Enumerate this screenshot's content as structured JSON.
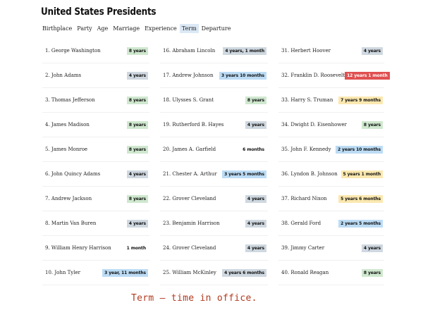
{
  "page": {
    "title": "United States Presidents",
    "caption": "Term – time in office."
  },
  "tabs": [
    {
      "label": "Birthplace",
      "active": false
    },
    {
      "label": "Party",
      "active": false
    },
    {
      "label": "Age",
      "active": false
    },
    {
      "label": "Marriage",
      "active": false
    },
    {
      "label": "Experience",
      "active": false
    },
    {
      "label": "Term",
      "active": true
    },
    {
      "label": "Departure",
      "active": false
    }
  ],
  "colors": {
    "green": "#cfe8cf",
    "gray": "#cfd8e0",
    "blue": "#bcdcf5",
    "yellow": "#fbe8b0",
    "red": "#e05050",
    "caption": "#b23a1e"
  },
  "presidents": [
    {
      "name": "1. George Washington",
      "term": "8 years",
      "color": "green"
    },
    {
      "name": "2. John Adams",
      "term": "4 years",
      "color": "gray"
    },
    {
      "name": "3. Thomas Jefferson",
      "term": "8 years",
      "color": "green"
    },
    {
      "name": "4. James Madison",
      "term": "8 years",
      "color": "green"
    },
    {
      "name": "5. James Monroe",
      "term": "8 years",
      "color": "green"
    },
    {
      "name": "6. John Quincy Adams",
      "term": "4 years",
      "color": "gray"
    },
    {
      "name": "7. Andrew Jackson",
      "term": "8 years",
      "color": "green"
    },
    {
      "name": "8. Martin Van Buren",
      "term": "4 years",
      "color": "gray"
    },
    {
      "name": "9. William Henry Harrison",
      "term": "1 month",
      "color": "none"
    },
    {
      "name": "10. John Tyler",
      "term": "3 year, 11 months",
      "color": "blue"
    },
    {
      "name": "16. Abraham Lincoln",
      "term": "4 years, 1 month",
      "color": "gray"
    },
    {
      "name": "17. Andrew Johnson",
      "term": "3 years 10 months",
      "color": "blue"
    },
    {
      "name": "18. Ulysses S. Grant",
      "term": "8 years",
      "color": "green"
    },
    {
      "name": "19. Rutherford B. Hayes",
      "term": "4 years",
      "color": "gray"
    },
    {
      "name": "20. James A. Garfield",
      "term": "6 months",
      "color": "none"
    },
    {
      "name": "21. Chester A. Arthur",
      "term": "3 years 5 months",
      "color": "blue"
    },
    {
      "name": "22. Grover Cleveland",
      "term": "4 years",
      "color": "gray"
    },
    {
      "name": "23. Benjamin Harrison",
      "term": "4 years",
      "color": "gray"
    },
    {
      "name": "24. Grover Cleveland",
      "term": "4 years",
      "color": "gray"
    },
    {
      "name": "25. William McKinley",
      "term": "4 years 6 months",
      "color": "gray"
    },
    {
      "name": "31. Herbert Hoover",
      "term": "4 years",
      "color": "gray"
    },
    {
      "name": "32. Franklin D. Roosevelt",
      "term": "12 years 1 month",
      "color": "red"
    },
    {
      "name": "33. Harry S. Truman",
      "term": "7 years 9 months",
      "color": "yellow"
    },
    {
      "name": "34. Dwight D. Eisenhower",
      "term": "8 years",
      "color": "green"
    },
    {
      "name": "35. John F. Kennedy",
      "term": "2 years 10 months",
      "color": "blue"
    },
    {
      "name": "36. Lyndon B. Johnson",
      "term": "5 years 1 month",
      "color": "yellow"
    },
    {
      "name": "37. Richard Nixon",
      "term": "5 years 6 months",
      "color": "yellow"
    },
    {
      "name": "38. Gerald Ford",
      "term": "2 years 5 months",
      "color": "blue"
    },
    {
      "name": "39. Jimmy Carter",
      "term": "4 years",
      "color": "gray"
    },
    {
      "name": "40. Ronald Reagan",
      "term": "8 years",
      "color": "green"
    }
  ]
}
